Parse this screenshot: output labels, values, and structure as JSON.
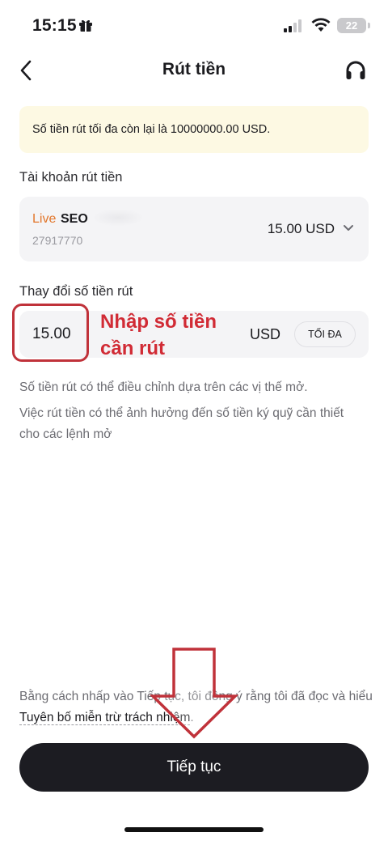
{
  "status_bar": {
    "time": "15:15",
    "battery_level": "22",
    "icons": [
      "gift-icon",
      "signal-icon",
      "wifi-icon",
      "battery-icon"
    ]
  },
  "header": {
    "title": "Rút tiền",
    "back_icon": "chevron-left-icon",
    "support_icon": "headset-icon"
  },
  "notice": {
    "text": "Số tiền rút tối đa còn lại là 10000000.00 USD."
  },
  "account_section": {
    "label": "Tài khoản rút tiền",
    "account": {
      "type": "Live",
      "name": "SEO",
      "number": "27917770",
      "balance": "15.00 USD"
    }
  },
  "amount_section": {
    "label": "Thay đổi số tiền rút",
    "value": "15.00",
    "currency": "USD",
    "max_button": "TỐI ĐA"
  },
  "annotation": {
    "line1": "Nhập số tiền",
    "line2": "cần rút",
    "color": "#d12b35"
  },
  "info": {
    "line1": "Số tiền rút có thể điều chỉnh dựa trên các vị thế mở.",
    "line2": "Việc rút tiền có thể ảnh hưởng đến số tiền ký quỹ cần thiết",
    "line3": "cho các lệnh mở"
  },
  "consent": {
    "prefix": "Bằng cách nhấp vào Tiếp tục, tôi đồng ý rằng tôi đã đọc và hiểu ",
    "link": "Tuyên bố miễn trừ trách nhiệm",
    "suffix": "."
  },
  "continue_button": "Tiếp tục",
  "colors": {
    "accent_live": "#e2762b",
    "notice_bg": "#fdf9e3",
    "button_bg": "#1c1c22",
    "annotation_red": "#c0323a"
  }
}
